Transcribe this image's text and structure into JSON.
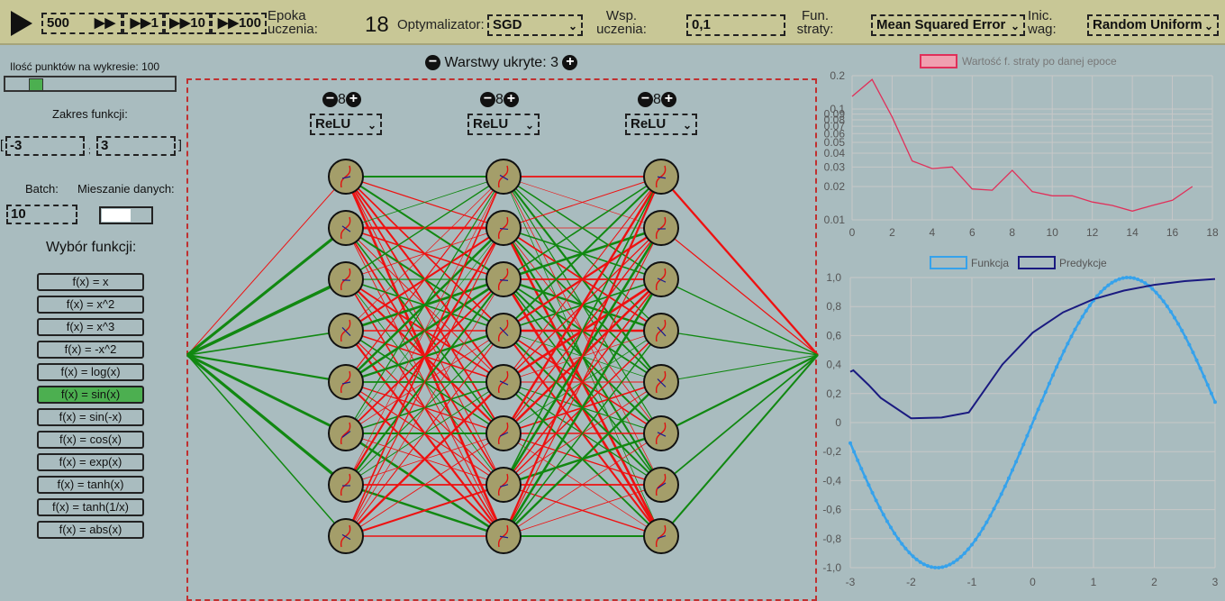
{
  "toolbar": {
    "epochs_value": "500",
    "step_buttons": [
      "▶▶",
      "▶▶1",
      "▶▶10",
      "▶▶100"
    ],
    "epoch_label": "Epoka uczenia:",
    "epoch_value": "18",
    "optimizer_label": "Optymalizator:",
    "optimizer_value": "SGD",
    "lr_label": "Wsp. uczenia:",
    "lr_value": "0,1",
    "loss_label": "Fun. straty:",
    "loss_value": "Mean Squared Error",
    "init_label": "Inic. wag:",
    "init_value": "Random Uniform"
  },
  "sidebar": {
    "points_label": "Ilość punktów na wykresie: 100",
    "points_slider": 0.15,
    "range_label": "Zakres funkcji:",
    "range_from": "-3",
    "range_to": "3",
    "range_open": "[",
    "range_sep": ";",
    "range_close": "]",
    "batch_label": "Batch:",
    "batch_value": "10",
    "shuffle_label": "Mieszanie danych:",
    "shuffle_on": false,
    "functions_title": "Wybór funkcji:",
    "functions": [
      "f(x) = x",
      "f(x) = x^2",
      "f(x) = x^3",
      "f(x) = -x^2",
      "f(x) = log(x)",
      "f(x) = sin(x)",
      "f(x) = sin(-x)",
      "f(x) = cos(x)",
      "f(x) = exp(x)",
      "f(x) = tanh(x)",
      "f(x) = tanh(1/x)",
      "f(x) = abs(x)"
    ],
    "active_function": "f(x) = sin(x)"
  },
  "network": {
    "hidden_label": "Warstwy ukryte: 3",
    "minus": "−",
    "plus": "+",
    "layers": [
      {
        "neurons": "8",
        "activation": "ReLU"
      },
      {
        "neurons": "8",
        "activation": "ReLU"
      },
      {
        "neurons": "8",
        "activation": "ReLU"
      }
    ]
  },
  "colors": {
    "positive": "#118811",
    "negative": "#ee1111",
    "neuron": "#a49e6a",
    "loss": "#e0305a",
    "function": "#36a2eb",
    "prediction": "#1a1a80"
  },
  "chart_data": [
    {
      "type": "line",
      "legend": [
        "Wartość f. straty po danej epoce"
      ],
      "y_scale": "log",
      "ylim": [
        0.01,
        0.2
      ],
      "y_ticks": [
        "0.2",
        "0.1",
        "0.09",
        "0.08",
        "0.07",
        "0.06",
        "0.05",
        "0.04",
        "0.03",
        "0.02",
        "0.01"
      ],
      "xlim": [
        0,
        18
      ],
      "x_ticks": [
        "0",
        "2",
        "4",
        "6",
        "8",
        "10",
        "12",
        "14",
        "16",
        "18"
      ],
      "series": [
        {
          "name": "Wartość f. straty po danej epoce",
          "x": [
            0,
            1,
            2,
            3,
            4,
            5,
            6,
            7,
            8,
            9,
            10,
            11,
            12,
            13,
            14,
            15,
            16,
            17
          ],
          "y": [
            0.13,
            0.185,
            0.085,
            0.034,
            0.029,
            0.03,
            0.019,
            0.0185,
            0.028,
            0.018,
            0.0165,
            0.0165,
            0.0145,
            0.0135,
            0.012,
            0.0135,
            0.015,
            0.02
          ]
        }
      ]
    },
    {
      "type": "line",
      "legend": [
        "Funkcja",
        "Predykcje"
      ],
      "xlim": [
        -3,
        3
      ],
      "ylim": [
        -1,
        1
      ],
      "x_ticks": [
        "-3",
        "-2",
        "-1",
        "0",
        "1",
        "2",
        "3"
      ],
      "y_ticks": [
        "1,0",
        "0,8",
        "0,6",
        "0,4",
        "0,2",
        "0",
        "-0,2",
        "-0,4",
        "-0,6",
        "-0,8",
        "-1,0"
      ],
      "series": [
        {
          "name": "Funkcja",
          "function": "sin(x)",
          "points": 100
        },
        {
          "name": "Predykcje",
          "x": [
            -3,
            -2.95,
            -2.7,
            -2.5,
            -2,
            -1.5,
            -1.05,
            -0.5,
            0,
            0.5,
            1,
            1.5,
            2,
            2.5,
            3
          ],
          "y": [
            0.35,
            0.36,
            0.26,
            0.17,
            0.03,
            0.035,
            0.07,
            0.4,
            0.62,
            0.76,
            0.85,
            0.91,
            0.95,
            0.975,
            0.99
          ]
        }
      ]
    }
  ]
}
